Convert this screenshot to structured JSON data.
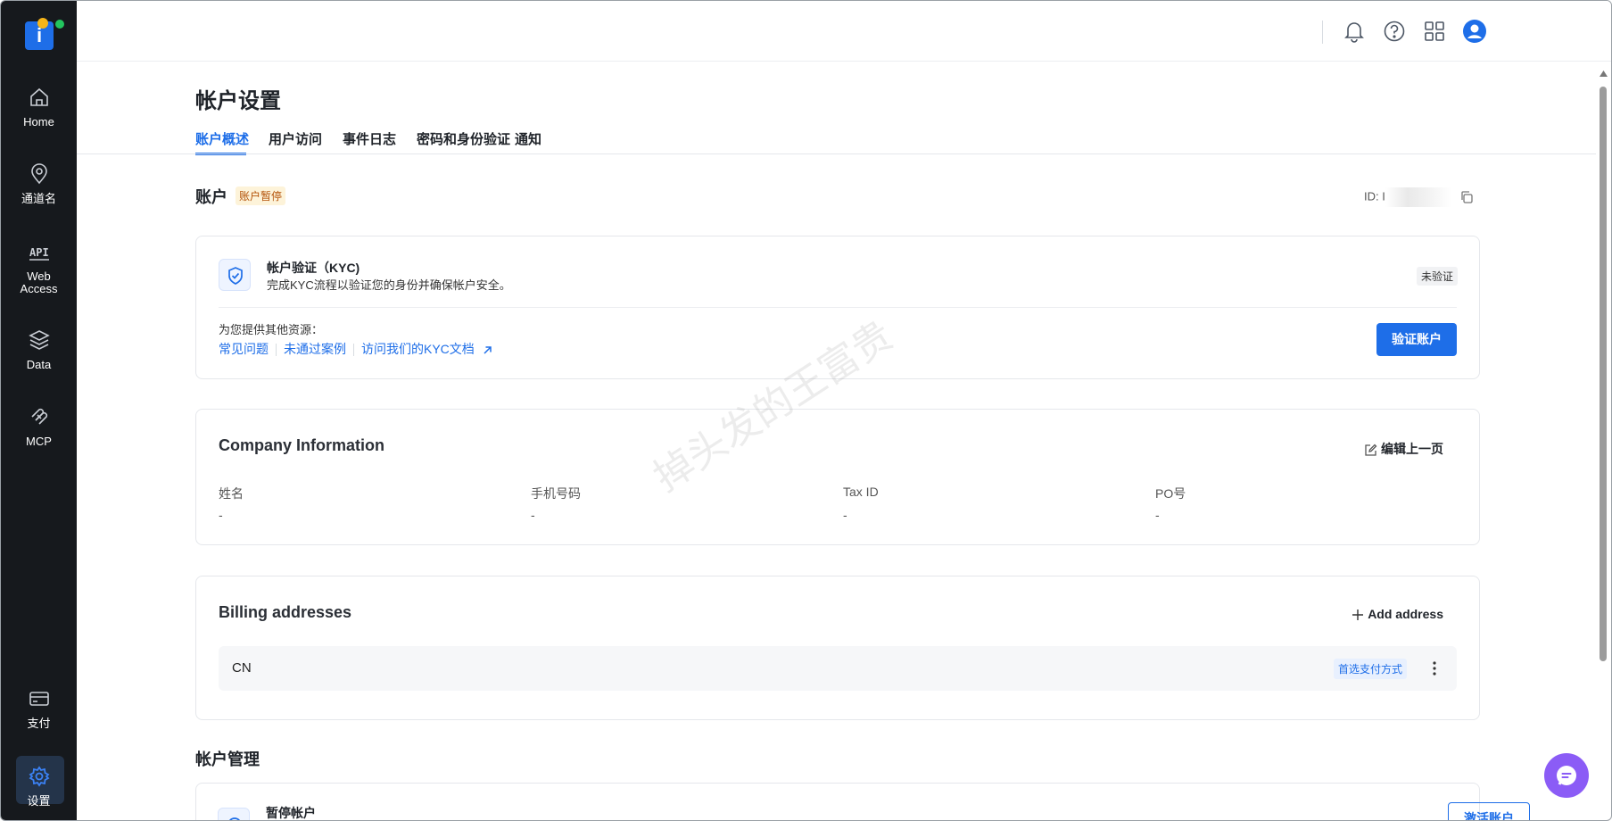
{
  "app": {
    "name": "i"
  },
  "sidebar": {
    "items": [
      {
        "key": "home",
        "label": "Home"
      },
      {
        "key": "channel",
        "label": "通道名"
      },
      {
        "key": "web-access",
        "label": "Web\nAccess"
      },
      {
        "key": "data",
        "label": "Data"
      },
      {
        "key": "mcp",
        "label": "MCP"
      },
      {
        "key": "pay",
        "label": "支付"
      },
      {
        "key": "settings",
        "label": "设置"
      }
    ],
    "active": "settings"
  },
  "topbar": {
    "icons": [
      "bell-icon",
      "help-icon",
      "apps-grid-icon",
      "user-avatar-icon"
    ]
  },
  "page": {
    "title": "帐户设置",
    "tabs": [
      "账户概述",
      "用户访问",
      "事件日志",
      "密码和身份验证",
      "通知"
    ],
    "active_tab": "账户概述"
  },
  "account": {
    "title": "账户",
    "status_badge": "账户暂停",
    "id_label": "ID: I"
  },
  "kyc": {
    "title": "帐户验证（KYC)",
    "description": "完成KYC流程以验证您的身份并确保帐户安全。",
    "status": "未验证",
    "resources_title": "为您提供其他资源：",
    "links": [
      "常见问题",
      "未通过案例",
      "访问我们的KYC文档"
    ],
    "verify_button": "验证账户"
  },
  "company": {
    "title": "Company Information",
    "edit_label": "编辑上一页",
    "fields": [
      {
        "label": "姓名",
        "value": "-"
      },
      {
        "label": "手机号码",
        "value": "-"
      },
      {
        "label": "Tax ID",
        "value": "-"
      },
      {
        "label": "PO号",
        "value": "-"
      }
    ]
  },
  "billing": {
    "title": "Billing addresses",
    "add_label": "Add address",
    "addresses": [
      {
        "country": "CN",
        "badge": "首选支付方式"
      }
    ]
  },
  "management": {
    "title": "帐户管理",
    "item_title": "暂停帐户",
    "activate_button": "激活账户"
  },
  "watermark": "掉头发的王富贵",
  "colors": {
    "accent": "#1e6ee8",
    "sidebar": "#16191d",
    "warn_bg": "#fdf3d9",
    "warn_text": "#b45309",
    "chat": "#8b5cf6"
  }
}
